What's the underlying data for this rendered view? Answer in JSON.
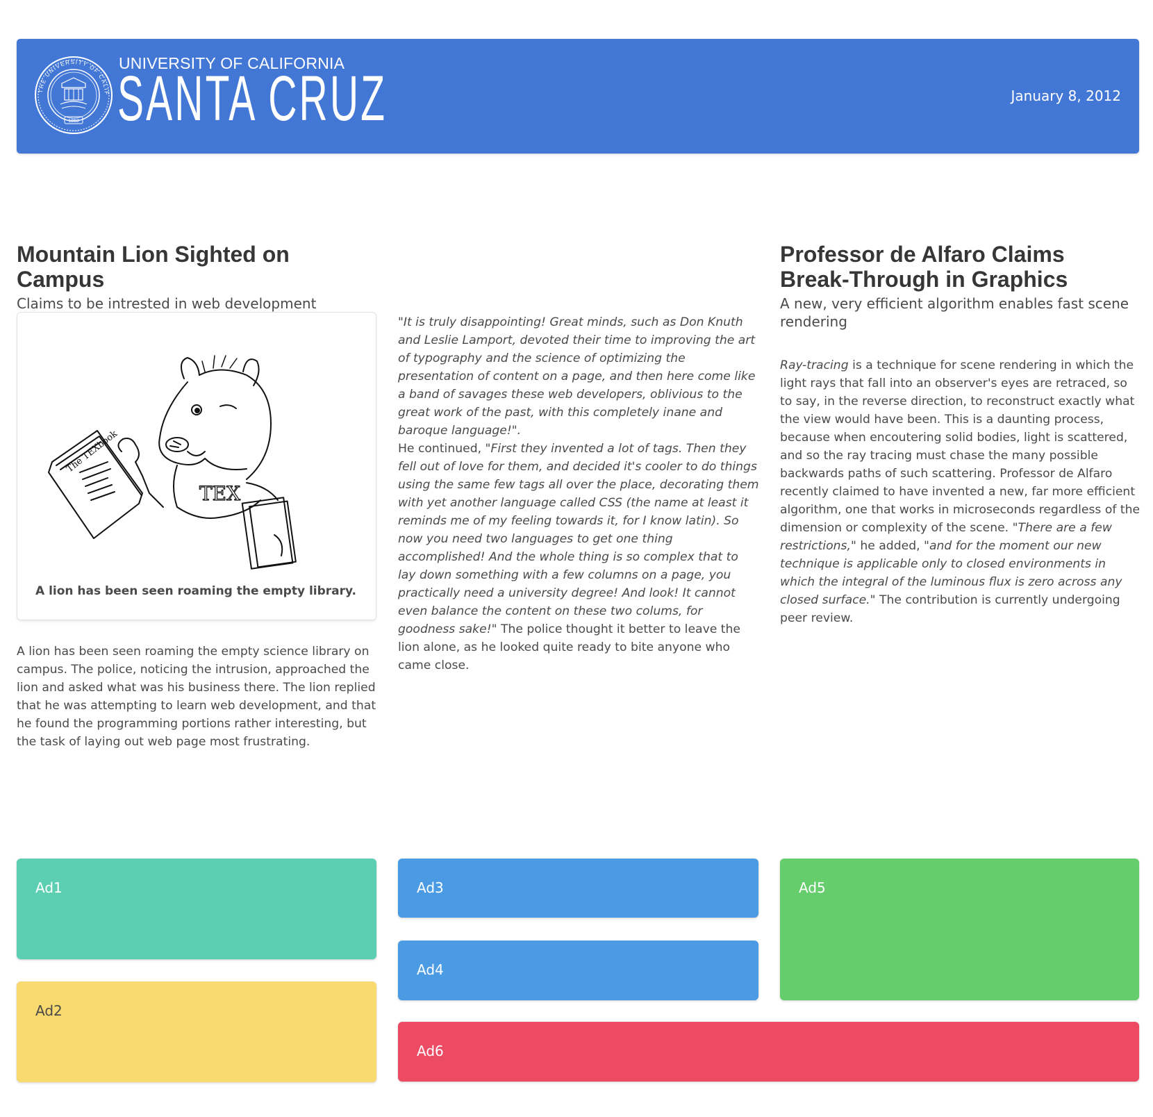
{
  "header": {
    "logo_top": "UNIVERSITY OF CALIFORNIA",
    "logo_main": "SANTA CRUZ",
    "seal_text": "THE UNIVERSITY OF CALIFORNIA 1868",
    "date": "January 8, 2012",
    "background_color": "#4277d6"
  },
  "article1": {
    "title": "Mountain Lion Sighted on Campus",
    "subtitle": "Claims to be intrested in web development",
    "figure_caption": "A lion has been seen roaming the empty library.",
    "figure_text": "The TEXbook",
    "body": "A lion has been seen roaming the empty science library on campus. The police, noticing the intrusion, approached the lion and asked what was his business there. The lion replied that he was attempting to learn web development, and that he found the programming portions rather interesting, but the task of laying out web page most frustrating."
  },
  "quote": {
    "q1": "\"It is truly disappointing! Great minds, such as Don Knuth and Leslie Lamport, devoted their time to improving the art of typography and the science of optimizing the presentation of content on a page, and then here come like a band of savages these web developers, oblivious to the great work of the past, with this completely inane and baroque language!\".",
    "lead": "He continued, ",
    "q2": "\"First they invented a lot of tags. Then they fell out of love for them, and decided it's cooler to do things using the same few tags all over the place, decorating them with yet another language called CSS (the name at least it reminds me of my feeling towards it, for I know latin). So now you need two languages to get one thing accomplished! And the whole thing is so complex that to lay down something with a few columns on a page, you practically need a university degree! And look! It cannot even balance the content on these two colums, for goodness sake!\"",
    "tail": " The police thought it better to leave the lion alone, as he looked quite ready to bite anyone who came close."
  },
  "article2": {
    "title": "Professor de Alfaro Claims Break-Through in Graphics",
    "subtitle": "A new, very efficient algorithm enables fast scene rendering",
    "term": "Ray-tracing",
    "body1": " is a technique for scene rendering in which the light rays that fall into an observer's eyes are retraced, so to say, in the reverse direction, to reconstruct exactly what the view would have been. This is a daunting process, because when encoutering solid bodies, light is scattered, and so the ray tracing must chase the many possible backwards paths of such scattering. Professor de Alfaro recently claimed to have invented a new, far more efficient algorithm, one that works in microseconds regardless of the dimension or complexity of the scene. ",
    "quote1": "\"There are a few restrictions,\"",
    "mid": " he added, ",
    "quote2": "\"and for the moment our new technique is applicable only to closed environments in which the integral of the luminous flux is zero across any closed surface.\"",
    "body2": " The contribution is currently undergoing peer review."
  },
  "ads": {
    "ad1": "Ad1",
    "ad2": "Ad2",
    "ad3": "Ad3",
    "ad4": "Ad4",
    "ad5": "Ad5",
    "ad6": "Ad6",
    "colors": {
      "ad1": "#5ccfb3",
      "ad2": "#f8da6f",
      "ad3": "#4a9be4",
      "ad4": "#4a9be4",
      "ad5": "#65cd6c",
      "ad6": "#ec4b63"
    }
  }
}
